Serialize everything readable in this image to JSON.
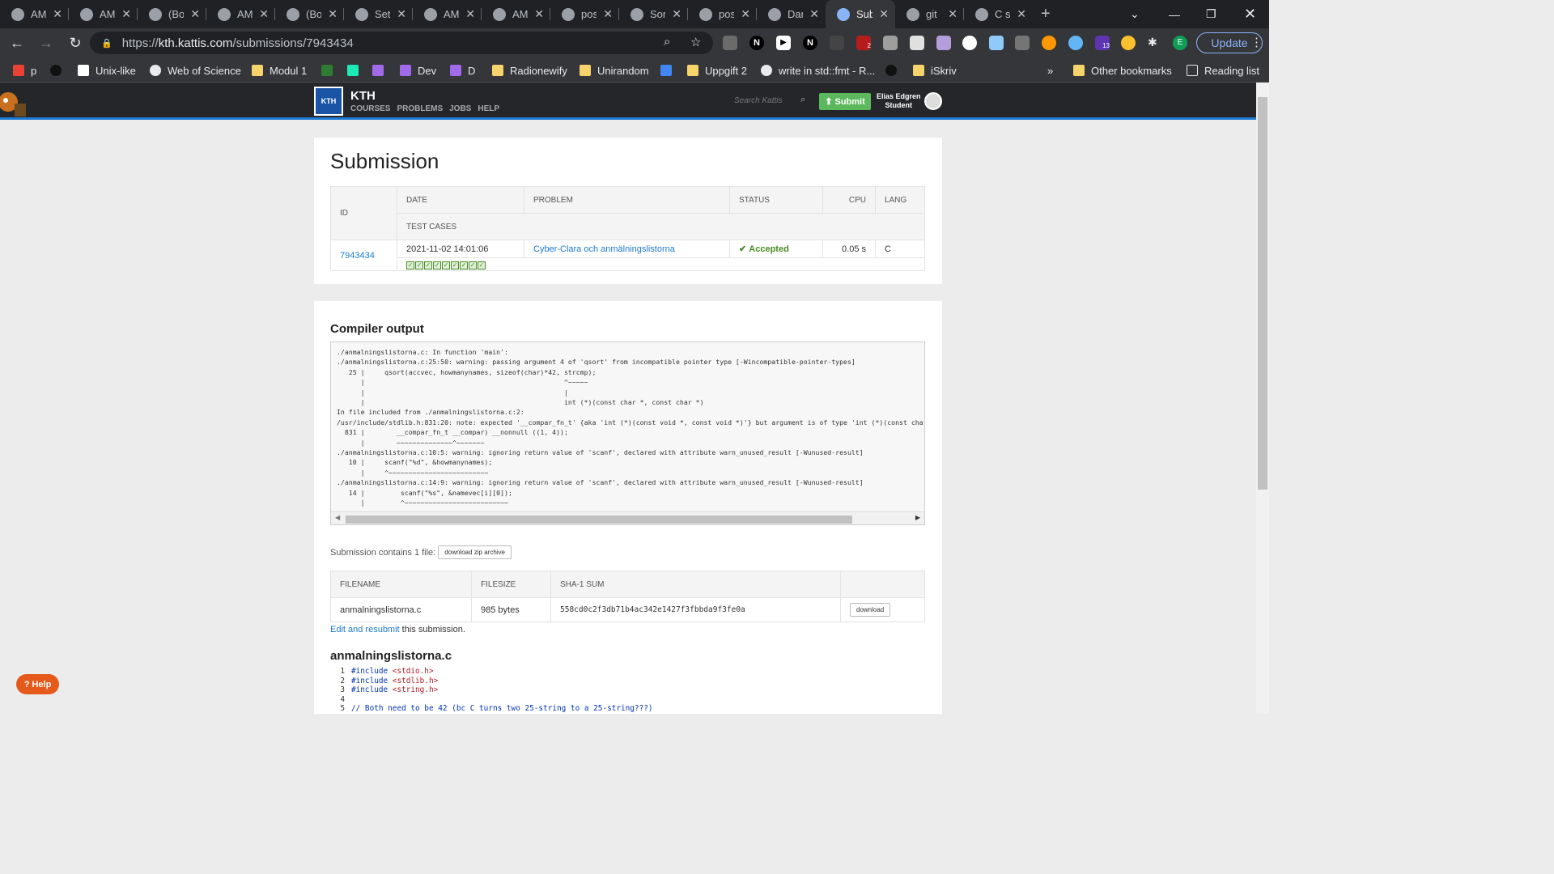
{
  "tabs": [
    {
      "label": "AM",
      "sep": true
    },
    {
      "label": "AM",
      "sep": true
    },
    {
      "label": "(Bo",
      "sep": true
    },
    {
      "label": "AM",
      "sep": true
    },
    {
      "label": "(Bo",
      "sep": true
    },
    {
      "label": "Sett",
      "sep": true
    },
    {
      "label": "AM",
      "sep": true
    },
    {
      "label": "AM",
      "sep": true
    },
    {
      "label": "pos",
      "sep": true
    },
    {
      "label": "Son",
      "sep": true
    },
    {
      "label": "pos",
      "sep": true
    },
    {
      "label": "Dar",
      "sep": false
    },
    {
      "label": "Sub",
      "active": true
    },
    {
      "label": "git",
      "sep": true
    },
    {
      "label": "C st",
      "sep": false
    }
  ],
  "toolbar": {
    "url_scheme": "https://",
    "url_host": "kth.kattis.com",
    "url_path": "/submissions/7943434",
    "update_label": "Update",
    "profile_initial": "E",
    "ext_badge_1": "2",
    "ext_badge_2": "13"
  },
  "bookmarks": [
    {
      "label": "p",
      "icon": "red"
    },
    {
      "label": "",
      "icon": "dark"
    },
    {
      "label": "Unix-like",
      "icon": "white"
    },
    {
      "label": "Web of Science",
      "icon": "globe"
    },
    {
      "label": "Modul 1",
      "icon": "folder"
    },
    {
      "label": "",
      "icon": "green"
    },
    {
      "label": "",
      "icon": "teal"
    },
    {
      "label": "",
      "icon": "purple"
    },
    {
      "label": "Dev",
      "icon": "purple"
    },
    {
      "label": "D",
      "icon": "purple"
    },
    {
      "label": "Radionewify",
      "icon": "folder"
    },
    {
      "label": "Unirandom",
      "icon": "folder"
    },
    {
      "label": "",
      "icon": "cloud"
    },
    {
      "label": "Uppgift 2",
      "icon": "folder"
    },
    {
      "label": "write in std::fmt - R...",
      "icon": "globe"
    },
    {
      "label": "",
      "icon": "dark"
    },
    {
      "label": "iSkriv",
      "icon": "folder"
    }
  ],
  "bookmarks_more": "»",
  "other_bookmarks": "Other bookmarks",
  "reading_list": "Reading list",
  "kattis": {
    "title": "KTH",
    "logo_text": "KTH",
    "menu": [
      "COURSES",
      "PROBLEMS",
      "JOBS",
      "HELP"
    ],
    "search_placeholder": "Search Kattis",
    "submit_label": "Submit",
    "user_name": "Elias Edgren",
    "user_role": "Student"
  },
  "submission": {
    "heading": "Submission",
    "columns": {
      "id": "ID",
      "date": "DATE",
      "problem": "PROBLEM",
      "status": "STATUS",
      "cpu": "CPU",
      "lang": "LANG",
      "test_cases": "TEST CASES"
    },
    "id": "7943434",
    "date": "2021-11-02 14:01:06",
    "problem": "Cyber-Clara och anmälningslistorna",
    "status": "Accepted",
    "cpu": "0.05 s",
    "lang": "C",
    "test_cases_passed": 9
  },
  "compiler": {
    "heading": "Compiler output",
    "output": "./anmalningslistorna.c: In function 'main':\n./anmalningslistorna.c:25:50: warning: passing argument 4 of 'qsort' from incompatible pointer type [-Wincompatible-pointer-types]\n   25 |     qsort(accvec, howmanynames, sizeof(char)*42, strcmp);\n      |                                                  ^~~~~~\n      |                                                  |\n      |                                                  int (*)(const char *, const char *)\nIn file included from ./anmalningslistorna.c:2:\n/usr/include/stdlib.h:831:20: note: expected '__compar_fn_t' {aka 'int (*)(const void *, const void *)'} but argument is of type 'int (*)(const char *, const char *)'\n  831 |        __compar_fn_t __compar) __nonnull ((1, 4));\n      |        ~~~~~~~~~~~~~~^~~~~~~~\n./anmalningslistorna.c:10:5: warning: ignoring return value of 'scanf', declared with attribute warn_unused_result [-Wunused-result]\n   10 |     scanf(\"%d\", &howmanynames);\n      |     ^~~~~~~~~~~~~~~~~~~~~~~~~~\n./anmalningslistorna.c:14:9: warning: ignoring return value of 'scanf', declared with attribute warn_unused_result [-Wunused-result]\n   14 |         scanf(\"%s\", &namevec[i][0]);\n      |         ^~~~~~~~~~~~~~~~~~~~~~~~~~~"
  },
  "files": {
    "contains_text": "Submission contains 1 file:",
    "zip_label": "download zip archive",
    "columns": {
      "filename": "FILENAME",
      "filesize": "FILESIZE",
      "sha1": "SHA-1 SUM"
    },
    "rows": [
      {
        "filename": "anmalningslistorna.c",
        "filesize": "985 bytes",
        "sha1": "558cd0c2f3db71b4ac342e1427f3fbbda9f3fe0a",
        "download_label": "download"
      }
    ],
    "edit_link": "Edit and resubmit",
    "edit_suffix": " this submission."
  },
  "source": {
    "filename": "anmalningslistorna.c",
    "lines": [
      {
        "n": "1",
        "kw": "#include",
        "rest": " <stdio.h>"
      },
      {
        "n": "2",
        "kw": "#include",
        "rest": " <stdlib.h>"
      },
      {
        "n": "3",
        "kw": "#include",
        "rest": " <string.h>"
      },
      {
        "n": "4",
        "kw": "",
        "rest": ""
      },
      {
        "n": "5",
        "kw": "",
        "rest": "// Both need to be 42 (bc C turns two 25-string to a 25-string???)"
      }
    ]
  },
  "help_label": "Help"
}
